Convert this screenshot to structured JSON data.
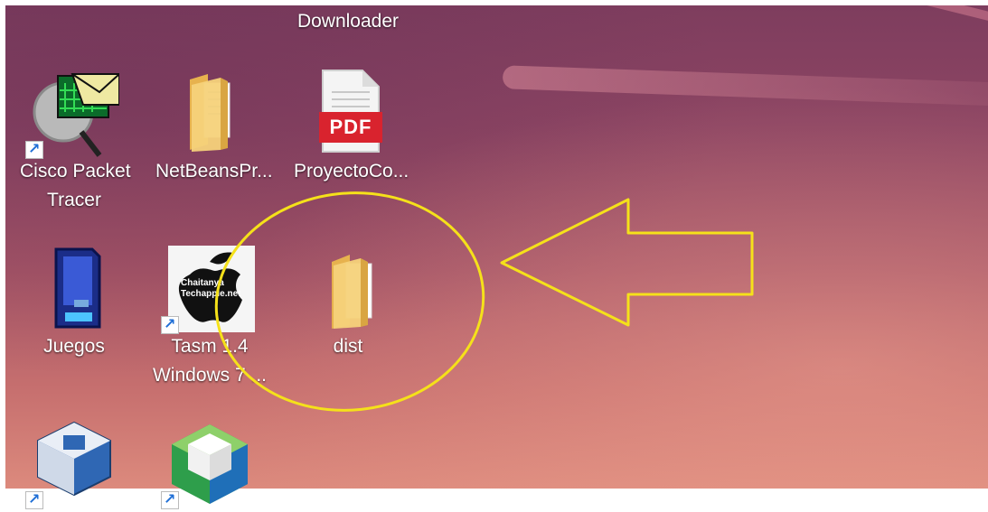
{
  "desktop": {
    "partial_label": "Downloader",
    "icons": [
      {
        "label": "Cisco Packet Tracer",
        "icon": "cisco-packet-tracer-icon",
        "shortcut": true
      },
      {
        "label": "NetBeansPr...",
        "icon": "folder-icon",
        "shortcut": false
      },
      {
        "label": "ProyectoCo...",
        "icon": "pdf-icon",
        "pdf_text": "PDF",
        "shortcut": false
      },
      {
        "label": "Juegos",
        "icon": "sd-card-icon",
        "shortcut": false
      },
      {
        "label": "Tasm 1.4 Windows 7 ...",
        "icon": "tasm-icon",
        "badge_text": "Chaitanya Techapple.net",
        "shortcut": true
      },
      {
        "label": "dist",
        "icon": "folder-icon",
        "shortcut": false,
        "highlighted": true
      },
      {
        "label": "",
        "icon": "virtualbox-icon",
        "shortcut": true
      },
      {
        "label": "",
        "icon": "netbeans-cube-icon",
        "shortcut": true
      }
    ]
  },
  "colors": {
    "annotation": "#f5e11a",
    "folder": "#f2c96b",
    "pdf_red": "#d9232e"
  }
}
